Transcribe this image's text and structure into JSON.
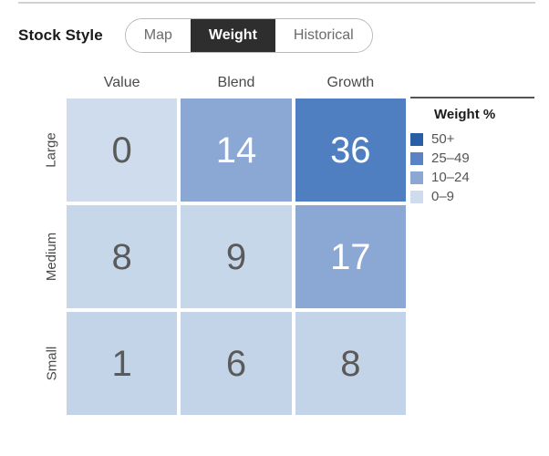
{
  "header": {
    "title": "Stock Style",
    "segmented_control": {
      "options": [
        "Map",
        "Weight",
        "Historical"
      ],
      "selected": "Weight"
    }
  },
  "legend": {
    "title": "Weight %",
    "items": [
      {
        "label": "50+",
        "color": "#2a5fa8"
      },
      {
        "label": "25–49",
        "color": "#5b82c2"
      },
      {
        "label": "10–24",
        "color": "#8ba8d4"
      },
      {
        "label": "0–9",
        "color": "#cfdced"
      }
    ]
  },
  "chart_data": {
    "type": "heatmap",
    "title": "Stock Style",
    "xlabel": "",
    "ylabel": "",
    "categories": [
      "Value",
      "Blend",
      "Growth"
    ],
    "rows": [
      "Large",
      "Medium",
      "Small"
    ],
    "unit": "%",
    "legend_position": "right",
    "grid": false,
    "values": [
      [
        0,
        14,
        36
      ],
      [
        8,
        9,
        17
      ],
      [
        1,
        6,
        8
      ]
    ],
    "cells": [
      [
        {
          "value": "0",
          "color": "#cfdced",
          "text_color": "#5a5a5a"
        },
        {
          "value": "14",
          "color": "#8ba8d4",
          "text_color": "#ffffff"
        },
        {
          "value": "36",
          "color": "#4f7fc0",
          "text_color": "#ffffff"
        }
      ],
      [
        {
          "value": "8",
          "color": "#c7d7ea",
          "text_color": "#5a5a5a"
        },
        {
          "value": "9",
          "color": "#c7d7ea",
          "text_color": "#5a5a5a"
        },
        {
          "value": "17",
          "color": "#8ba8d4",
          "text_color": "#ffffff"
        }
      ],
      [
        {
          "value": "1",
          "color": "#c4d4e8",
          "text_color": "#5a5a5a"
        },
        {
          "value": "6",
          "color": "#c4d4e8",
          "text_color": "#5a5a5a"
        },
        {
          "value": "8",
          "color": "#c4d4e8",
          "text_color": "#5a5a5a"
        }
      ]
    ],
    "bins": [
      {
        "label": "50+",
        "min": 50,
        "max": null,
        "color": "#2a5fa8"
      },
      {
        "label": "25–49",
        "min": 25,
        "max": 49,
        "color": "#5b82c2"
      },
      {
        "label": "10–24",
        "min": 10,
        "max": 24,
        "color": "#8ba8d4"
      },
      {
        "label": "0–9",
        "min": 0,
        "max": 9,
        "color": "#cfdced"
      }
    ]
  }
}
